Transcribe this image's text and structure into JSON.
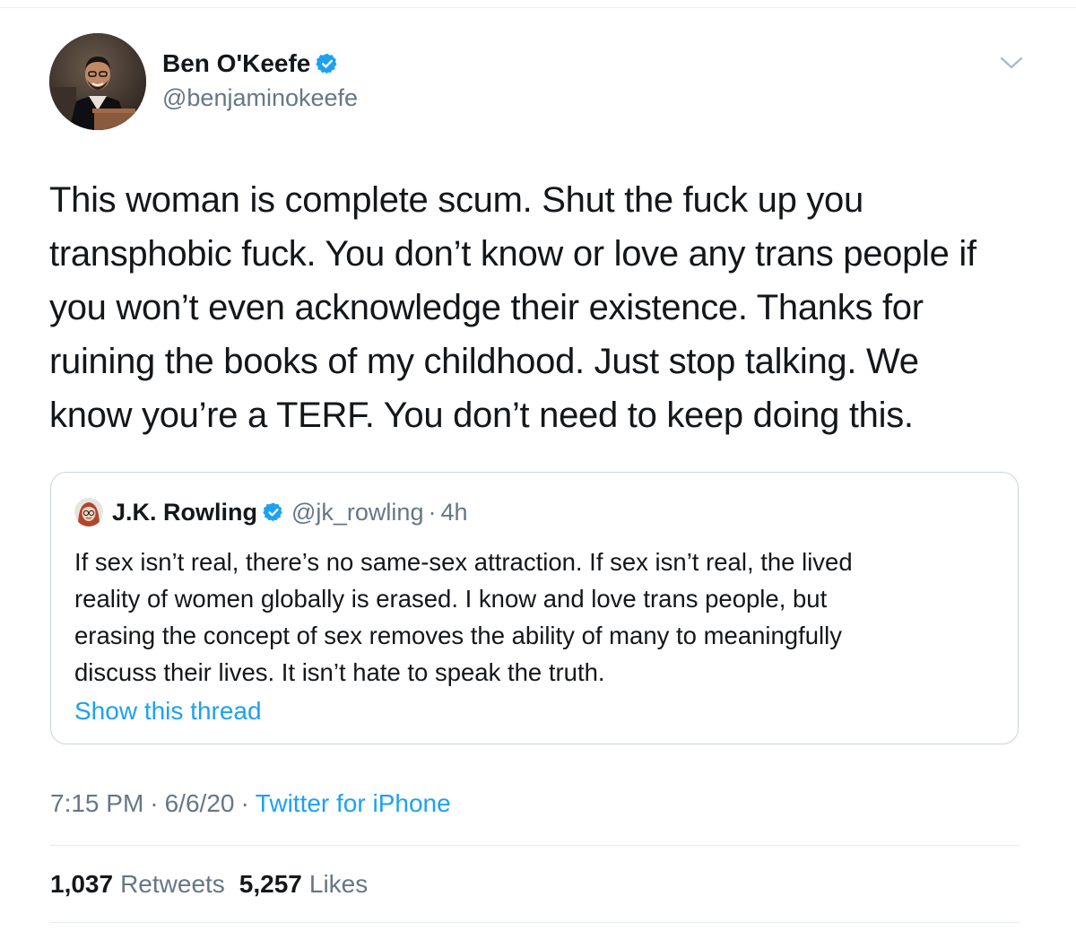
{
  "tweet": {
    "author": {
      "display_name": "Ben O'Keefe",
      "handle": "@benjaminokeefe",
      "verified": true
    },
    "text_lines": [
      "This woman is complete scum. Shut the fuck up you",
      "transphobic fuck. You don’t know or love any trans people if",
      "you won’t even acknowledge their existence. Thanks for",
      "ruining the books of my childhood. Just stop talking. We",
      "know you’re a TERF. You don’t need to keep doing this."
    ],
    "quoted": {
      "display_name": "J.K. Rowling",
      "handle": "@jk_rowling",
      "separator": "·",
      "time": "4h",
      "verified": true,
      "text_lines": [
        "If sex isn’t real, there’s no same-sex attraction. If sex isn’t real, the lived",
        "reality of women globally is erased. I know and love trans people, but",
        "erasing the concept of sex removes the ability of many to meaningfully",
        "discuss their lives. It isn’t hate to speak the truth."
      ],
      "show_thread": "Show this thread"
    },
    "meta": {
      "time": "7:15 PM",
      "sep1": "·",
      "date": "6/6/20",
      "sep2": "·",
      "source": "Twitter for iPhone"
    },
    "stats": {
      "retweets_count": "1,037",
      "retweets_label": "Retweets",
      "likes_count": "5,257",
      "likes_label": "Likes"
    }
  },
  "colors": {
    "accent": "#1da1f2",
    "text": "#14171a",
    "secondary": "#657786",
    "divider": "#e6ecf0"
  },
  "icons": {
    "verified": "verified-badge-icon",
    "more": "chevron-down-icon"
  }
}
